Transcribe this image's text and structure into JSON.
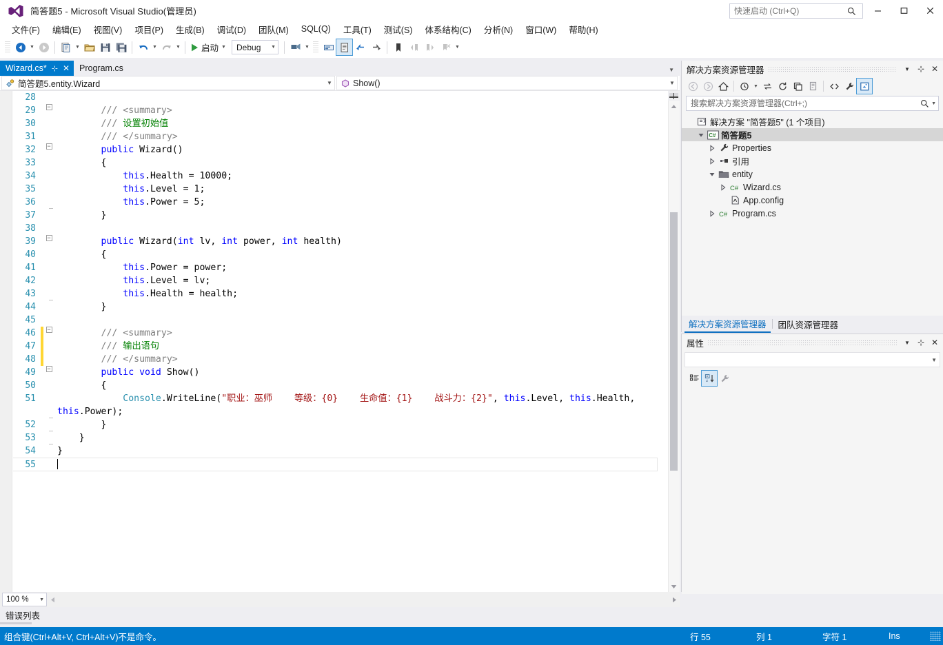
{
  "window": {
    "title": "简答题5 - Microsoft Visual Studio(管理员)",
    "logo_icon": "visual-studio-logo-icon",
    "minimize_icon": "minimize-icon",
    "maximize_icon": "maximize-icon",
    "close_icon": "close-icon"
  },
  "quick_launch": {
    "placeholder": "快速启动 (Ctrl+Q)",
    "value": "",
    "icon": "search-icon"
  },
  "menu": {
    "items": [
      {
        "label": "文件(F)"
      },
      {
        "label": "编辑(E)"
      },
      {
        "label": "视图(V)"
      },
      {
        "label": "项目(P)"
      },
      {
        "label": "生成(B)"
      },
      {
        "label": "调试(D)"
      },
      {
        "label": "团队(M)"
      },
      {
        "label": "SQL(Q)"
      },
      {
        "label": "工具(T)"
      },
      {
        "label": "测试(S)"
      },
      {
        "label": "体系结构(C)"
      },
      {
        "label": "分析(N)"
      },
      {
        "label": "窗口(W)"
      },
      {
        "label": "帮助(H)"
      }
    ]
  },
  "toolbar": {
    "navigate_back_icon": "navigate-back-icon",
    "navigate_forward_icon": "navigate-forward-icon",
    "new_project_icon": "new-project-icon",
    "open_file_icon": "open-file-icon",
    "save_icon": "save-icon",
    "save_all_icon": "save-all-icon",
    "undo_icon": "undo-icon",
    "redo_icon": "redo-icon",
    "start_icon": "start-play-icon",
    "start_label": "启动",
    "config_value": "Debug",
    "attach_icon": "attach-to-process-icon",
    "step_icon": "step-icon",
    "comment_icon": "comment-selection-icon",
    "uncomment_icon": "uncomment-selection-icon",
    "undo_nav_icon": "undo-navigation-icon",
    "redo_nav_icon": "redo-navigation-icon",
    "bookmark_icon": "bookmark-icon",
    "prev_bookmark_icon": "previous-bookmark-icon",
    "next_bookmark_icon": "next-bookmark-icon",
    "clear_bookmark_icon": "clear-bookmarks-icon",
    "overflow_icon": "toolbar-overflow-icon"
  },
  "document_tabs": [
    {
      "label": "Wizard.cs*",
      "active": true,
      "pin_icon": "pin-icon",
      "close_icon": "close-icon"
    },
    {
      "label": "Program.cs",
      "active": false
    }
  ],
  "navbar": {
    "type_icon": "class-icon",
    "type_value": "简答题5.entity.Wizard",
    "member_icon": "method-icon",
    "member_value": "Show()"
  },
  "editor": {
    "zoom": "100 %",
    "lines": [
      {
        "num": "28",
        "fold": "none",
        "guide": "none",
        "changed": false,
        "text": ""
      },
      {
        "num": "29",
        "fold": "minus",
        "guide": "none",
        "changed": false,
        "segments": [
          {
            "t": "        ",
            "c": "n"
          },
          {
            "t": "/// ",
            "c": "cdoc"
          },
          {
            "t": "<summary>",
            "c": "cdoc"
          }
        ]
      },
      {
        "num": "30",
        "fold": "none",
        "guide": "line",
        "changed": false,
        "segments": [
          {
            "t": "        ",
            "c": "n"
          },
          {
            "t": "/// ",
            "c": "cdoc"
          },
          {
            "t": "设置初始值",
            "c": "c"
          }
        ]
      },
      {
        "num": "31",
        "fold": "none",
        "guide": "line",
        "changed": false,
        "segments": [
          {
            "t": "        ",
            "c": "n"
          },
          {
            "t": "/// ",
            "c": "cdoc"
          },
          {
            "t": "</summary>",
            "c": "cdoc"
          }
        ]
      },
      {
        "num": "32",
        "fold": "minus",
        "guide": "none",
        "changed": false,
        "segments": [
          {
            "t": "        ",
            "c": "n"
          },
          {
            "t": "public ",
            "c": "k"
          },
          {
            "t": "Wizard()",
            "c": "n"
          }
        ]
      },
      {
        "num": "33",
        "fold": "none",
        "guide": "line",
        "changed": false,
        "segments": [
          {
            "t": "        {",
            "c": "n"
          }
        ]
      },
      {
        "num": "34",
        "fold": "none",
        "guide": "line",
        "changed": false,
        "segments": [
          {
            "t": "            ",
            "c": "n"
          },
          {
            "t": "this",
            "c": "k"
          },
          {
            "t": ".Health = 10000;",
            "c": "n"
          }
        ]
      },
      {
        "num": "35",
        "fold": "none",
        "guide": "line",
        "changed": false,
        "segments": [
          {
            "t": "            ",
            "c": "n"
          },
          {
            "t": "this",
            "c": "k"
          },
          {
            "t": ".Level = 1;",
            "c": "n"
          }
        ]
      },
      {
        "num": "36",
        "fold": "none",
        "guide": "line",
        "changed": false,
        "segments": [
          {
            "t": "            ",
            "c": "n"
          },
          {
            "t": "this",
            "c": "k"
          },
          {
            "t": ".Power = 5;",
            "c": "n"
          }
        ]
      },
      {
        "num": "37",
        "fold": "none",
        "guide": "end",
        "changed": false,
        "segments": [
          {
            "t": "        }",
            "c": "n"
          }
        ]
      },
      {
        "num": "38",
        "fold": "none",
        "guide": "none",
        "changed": false,
        "text": ""
      },
      {
        "num": "39",
        "fold": "minus",
        "guide": "none",
        "changed": false,
        "segments": [
          {
            "t": "        ",
            "c": "n"
          },
          {
            "t": "public ",
            "c": "k"
          },
          {
            "t": "Wizard(",
            "c": "n"
          },
          {
            "t": "int",
            "c": "k"
          },
          {
            "t": " lv, ",
            "c": "n"
          },
          {
            "t": "int",
            "c": "k"
          },
          {
            "t": " power, ",
            "c": "n"
          },
          {
            "t": "int",
            "c": "k"
          },
          {
            "t": " health)",
            "c": "n"
          }
        ]
      },
      {
        "num": "40",
        "fold": "none",
        "guide": "line",
        "changed": false,
        "segments": [
          {
            "t": "        {",
            "c": "n"
          }
        ]
      },
      {
        "num": "41",
        "fold": "none",
        "guide": "line",
        "changed": false,
        "segments": [
          {
            "t": "            ",
            "c": "n"
          },
          {
            "t": "this",
            "c": "k"
          },
          {
            "t": ".Power = power;",
            "c": "n"
          }
        ]
      },
      {
        "num": "42",
        "fold": "none",
        "guide": "line",
        "changed": false,
        "segments": [
          {
            "t": "            ",
            "c": "n"
          },
          {
            "t": "this",
            "c": "k"
          },
          {
            "t": ".Level = lv;",
            "c": "n"
          }
        ]
      },
      {
        "num": "43",
        "fold": "none",
        "guide": "line",
        "changed": false,
        "segments": [
          {
            "t": "            ",
            "c": "n"
          },
          {
            "t": "this",
            "c": "k"
          },
          {
            "t": ".Health = health;",
            "c": "n"
          }
        ]
      },
      {
        "num": "44",
        "fold": "none",
        "guide": "end",
        "changed": false,
        "segments": [
          {
            "t": "        }",
            "c": "n"
          }
        ]
      },
      {
        "num": "45",
        "fold": "none",
        "guide": "none",
        "changed": false,
        "text": ""
      },
      {
        "num": "46",
        "fold": "minus",
        "guide": "none",
        "changed": true,
        "segments": [
          {
            "t": "        ",
            "c": "n"
          },
          {
            "t": "/// ",
            "c": "cdoc"
          },
          {
            "t": "<summary>",
            "c": "cdoc"
          }
        ]
      },
      {
        "num": "47",
        "fold": "none",
        "guide": "line",
        "changed": true,
        "segments": [
          {
            "t": "        ",
            "c": "n"
          },
          {
            "t": "/// ",
            "c": "cdoc"
          },
          {
            "t": "输出语句",
            "c": "c"
          }
        ]
      },
      {
        "num": "48",
        "fold": "none",
        "guide": "line",
        "changed": true,
        "segments": [
          {
            "t": "        ",
            "c": "n"
          },
          {
            "t": "/// ",
            "c": "cdoc"
          },
          {
            "t": "</summary>",
            "c": "cdoc"
          }
        ]
      },
      {
        "num": "49",
        "fold": "minus",
        "guide": "none",
        "changed": false,
        "segments": [
          {
            "t": "        ",
            "c": "n"
          },
          {
            "t": "public void ",
            "c": "k"
          },
          {
            "t": "Show()",
            "c": "n"
          }
        ]
      },
      {
        "num": "50",
        "fold": "none",
        "guide": "line",
        "changed": false,
        "segments": [
          {
            "t": "        {",
            "c": "n"
          }
        ]
      },
      {
        "num": "51",
        "fold": "none",
        "guide": "line",
        "changed": false,
        "wrapped": true,
        "segments": [
          {
            "t": "            ",
            "c": "n"
          },
          {
            "t": "Console",
            "c": "cls"
          },
          {
            "t": ".WriteLine(",
            "c": "n"
          },
          {
            "t": "\"职业：巫师    等级：{0}    生命值：{1}    战斗力：{2}\"",
            "c": "s"
          },
          {
            "t": ", ",
            "c": "n"
          },
          {
            "t": "this",
            "c": "k"
          },
          {
            "t": ".Level, ",
            "c": "n"
          },
          {
            "t": "this",
            "c": "k"
          },
          {
            "t": ".Health, ",
            "c": "n"
          },
          {
            "t": "this",
            "c": "k"
          },
          {
            "t": ".Power);",
            "c": "n"
          }
        ]
      },
      {
        "num": "52",
        "fold": "none",
        "guide": "end",
        "changed": false,
        "segments": [
          {
            "t": "        }",
            "c": "n"
          }
        ]
      },
      {
        "num": "53",
        "fold": "none",
        "guide": "end2",
        "changed": false,
        "segments": [
          {
            "t": "    }",
            "c": "n"
          }
        ]
      },
      {
        "num": "54",
        "fold": "none",
        "guide": "end3",
        "changed": false,
        "segments": [
          {
            "t": "}",
            "c": "n"
          }
        ]
      },
      {
        "num": "55",
        "fold": "none",
        "guide": "none",
        "changed": false,
        "current": true,
        "text": ""
      }
    ]
  },
  "solution_explorer": {
    "title": "解决方案资源管理器",
    "dropdown_icon": "chevron-down-icon",
    "pin_icon": "pin-icon",
    "close_icon": "close-icon",
    "toolbar": {
      "back_icon": "back-icon",
      "forward_icon": "forward-icon",
      "home_icon": "home-icon",
      "pending_changes_icon": "pending-changes-filter-icon",
      "sync_icon": "sync-with-active-document-icon",
      "refresh_icon": "refresh-icon",
      "collapse_all_icon": "collapse-all-icon",
      "show_all_files_icon": "show-all-files-icon",
      "view_code_icon": "view-code-icon",
      "properties_icon": "properties-wrench-icon",
      "preview_icon": "preview-selected-items-icon"
    },
    "search_placeholder": "搜索解决方案资源管理器(Ctrl+;)",
    "search_value": "",
    "search_icon": "search-icon",
    "search_caret_icon": "chevron-down-icon",
    "tree": [
      {
        "label": "解决方案 \"简答题5\" (1 个项目)",
        "indent": 0,
        "expander": "none",
        "icon": "solution-icon",
        "selected": false,
        "bold": false
      },
      {
        "label": "简答题5",
        "indent": 1,
        "expander": "expanded",
        "icon": "csharp-project-icon",
        "selected": true,
        "bold": true
      },
      {
        "label": "Properties",
        "indent": 2,
        "expander": "collapsed",
        "icon": "wrench-icon",
        "selected": false,
        "bold": false
      },
      {
        "label": "引用",
        "indent": 2,
        "expander": "collapsed",
        "icon": "references-icon",
        "selected": false,
        "bold": false
      },
      {
        "label": "entity",
        "indent": 2,
        "expander": "expanded",
        "icon": "folder-icon",
        "selected": false,
        "bold": false
      },
      {
        "label": "Wizard.cs",
        "indent": 3,
        "expander": "collapsed",
        "icon": "csharp-file-icon",
        "selected": false,
        "bold": false
      },
      {
        "label": "App.config",
        "indent": 3,
        "expander": "none",
        "icon": "config-file-icon",
        "selected": false,
        "bold": false
      },
      {
        "label": "Program.cs",
        "indent": 2,
        "expander": "collapsed",
        "icon": "csharp-file-icon",
        "selected": false,
        "bold": false
      }
    ],
    "bottom_tabs": [
      {
        "label": "解决方案资源管理器",
        "active": true
      },
      {
        "label": "团队资源管理器",
        "active": false
      }
    ]
  },
  "properties_pane": {
    "title": "属性",
    "dropdown_icon": "chevron-down-icon",
    "pin_icon": "pin-icon",
    "close_icon": "close-icon",
    "object_value": "",
    "object_caret_icon": "chevron-down-icon",
    "categorized_icon": "categorized-view-icon",
    "alphabetical_icon": "alphabetical-sort-icon",
    "property_pages_icon": "property-pages-wrench-icon"
  },
  "error_list": {
    "label": "错误列表"
  },
  "status_bar": {
    "message": "组合键(Ctrl+Alt+V, Ctrl+Alt+V)不是命令。",
    "line_label": "行 55",
    "col_label": "列 1",
    "char_label": "字符 1",
    "insert_mode": "Ins",
    "grip_icon": "resize-grip-icon"
  },
  "colors": {
    "accent": "#007acc",
    "titlebar_bg": "#ffffff",
    "chrome_bg": "#eeeef2",
    "editor_bg": "#ffffff",
    "keyword": "#0000ff",
    "string": "#a31515",
    "comment": "#008000",
    "xmldoc": "#808080",
    "type": "#2b91af",
    "linenum": "#2b91af",
    "changed_marker": "#ffd633"
  }
}
